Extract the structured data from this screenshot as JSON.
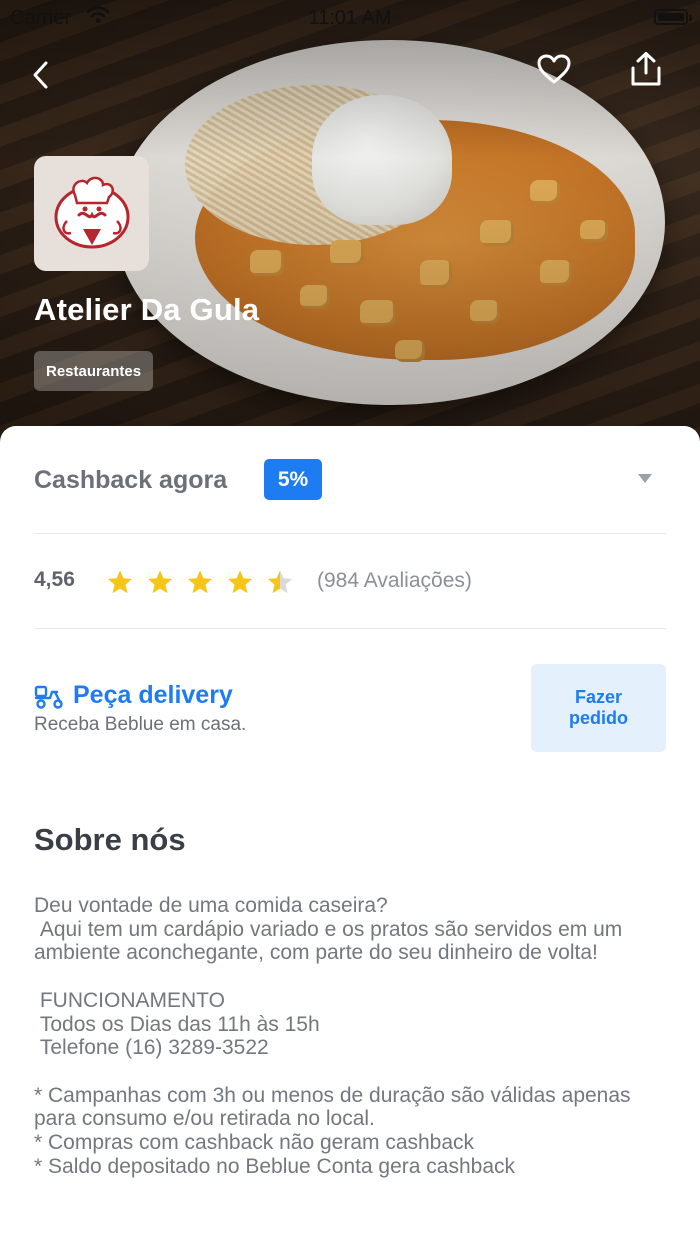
{
  "status_bar": {
    "carrier": "Carrier",
    "time": "11:01 AM"
  },
  "header": {
    "back_icon": "chevron-left-icon",
    "favorite_icon": "heart-icon",
    "share_icon": "share-icon"
  },
  "store": {
    "name": "Atelier Da Gula",
    "category": "Restaurantes",
    "logo_icon": "chef-logo-icon"
  },
  "cashback": {
    "label": "Cashback agora",
    "percent": "5%"
  },
  "rating": {
    "value": "4,56",
    "stars": 4.5,
    "max_stars": 5,
    "reviews": "(984 Avaliações)"
  },
  "delivery": {
    "title": "Peça delivery",
    "subtitle": "Receba Beblue em casa.",
    "button_label": "Fazer pedido",
    "icon": "delivery-scooter-icon"
  },
  "about": {
    "title": "Sobre nós",
    "text": "Deu vontade de uma comida caseira?\n Aqui tem um cardápio variado e os pratos são servidos em um ambiente aconchegante, com parte do seu dinheiro de volta!\n\n FUNCIONAMENTO\n Todos os Dias das 11h às 15h\n Telefone (16) 3289-3522\n\n* Campanhas com 3h ou menos de duração são válidas apenas para consumo e/ou retirada no local.\n* Compras com cashback não geram cashback\n* Saldo depositado no Beblue Conta gera cashback"
  },
  "colors": {
    "accent": "#1e7cf2",
    "star": "#f5c518",
    "star_empty": "#d9d9d9",
    "text_muted": "#6b7079"
  }
}
